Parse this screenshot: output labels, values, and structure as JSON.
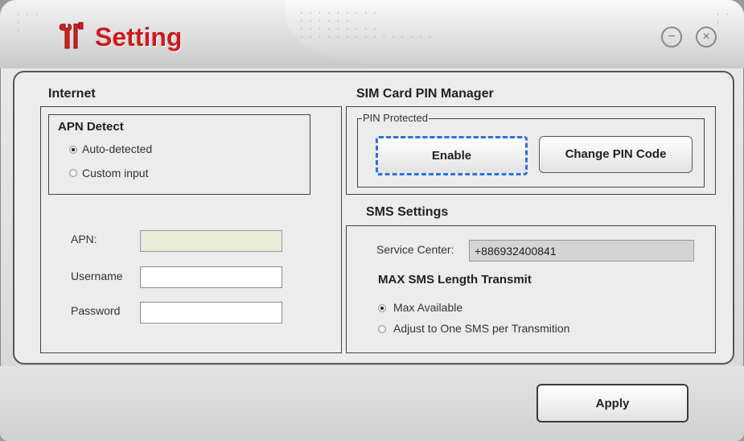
{
  "window": {
    "title": "Setting",
    "minimize_icon": "minimize-icon",
    "close_icon": "close-icon"
  },
  "internet": {
    "title": "Internet",
    "apn_detect": {
      "title": "APN Detect",
      "options": [
        "Auto-detected",
        "Custom input"
      ],
      "selected": "Auto-detected"
    },
    "apn_label": "APN:",
    "apn_value": "",
    "username_label": "Username",
    "username_value": "",
    "password_label": "Password",
    "password_value": ""
  },
  "sim_pin": {
    "title": "SIM Card PIN Manager",
    "group_label": "PIN Protected",
    "enable_label": "Enable",
    "change_label": "Change PIN Code"
  },
  "sms": {
    "title": "SMS Settings",
    "service_center_label": "Service Center:",
    "service_center_value": "+886932400841",
    "max_length_title": "MAX SMS Length Transmit",
    "options": [
      "Max Available",
      "Adjust to One SMS per Transmition"
    ],
    "selected": "Max Available"
  },
  "footer": {
    "apply_label": "Apply"
  }
}
